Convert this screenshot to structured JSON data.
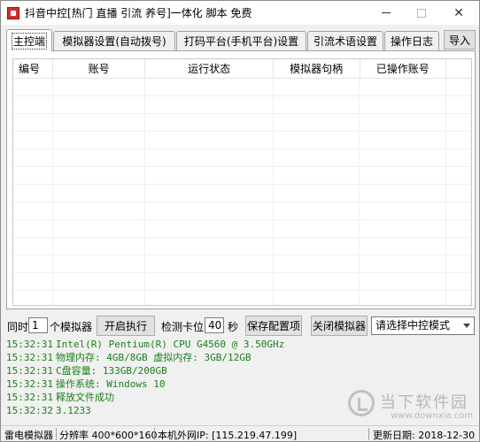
{
  "window": {
    "title": "抖音中控[热门 直播 引流 养号]一体化 脚本  免费"
  },
  "tabs": [
    {
      "label": "主控端",
      "active": true
    },
    {
      "label": "模拟器设置(自动拨号)",
      "active": false
    },
    {
      "label": "打码平台(手机平台)设置",
      "active": false
    },
    {
      "label": "引流术语设置",
      "active": false
    },
    {
      "label": "操作日志",
      "active": false
    }
  ],
  "import_label": "导入",
  "table": {
    "columns": [
      "编号",
      "账号",
      "运行状态",
      "模拟器句柄",
      "已操作账号"
    ],
    "rows": []
  },
  "controls": {
    "concurrent_label": "同时",
    "concurrent_value": "1",
    "emulator_unit_label": "个模拟器",
    "start_button": "开启执行",
    "detect_label": "检测卡位",
    "detect_value": "40",
    "seconds_label": "秒",
    "save_button": "保存配置项",
    "close_emulator_button": "关闭模拟器",
    "mode_select": "请选择中控模式"
  },
  "log": [
    {
      "time": "15:32:31",
      "text": "Intel(R) Pentium(R) CPU G4560 @ 3.50GHz"
    },
    {
      "time": "15:32:31",
      "text": "物理内存: 4GB/8GB   虚拟内存: 3GB/12GB"
    },
    {
      "time": "15:32:31",
      "text": "C盘容量: 133GB/200GB"
    },
    {
      "time": "15:32:31",
      "text": "操作系统: Windows 10"
    },
    {
      "time": "15:32:31",
      "text": "释放文件成功"
    },
    {
      "time": "15:32:32",
      "text": "3.1233"
    }
  ],
  "statusbar": {
    "emulator": "雷电模拟器",
    "resolution": "分辨率  400*600*160",
    "ip": "本机外网IP: [115.219.47.199]",
    "update": "更新日期: 2018-12-30"
  },
  "watermark": {
    "title": "当下软件园",
    "url": "www.downxia.com"
  },
  "colors": {
    "log_text": "#1a7f1a",
    "window_bg": "#f0f0f0",
    "app_icon": "#d0302b"
  }
}
